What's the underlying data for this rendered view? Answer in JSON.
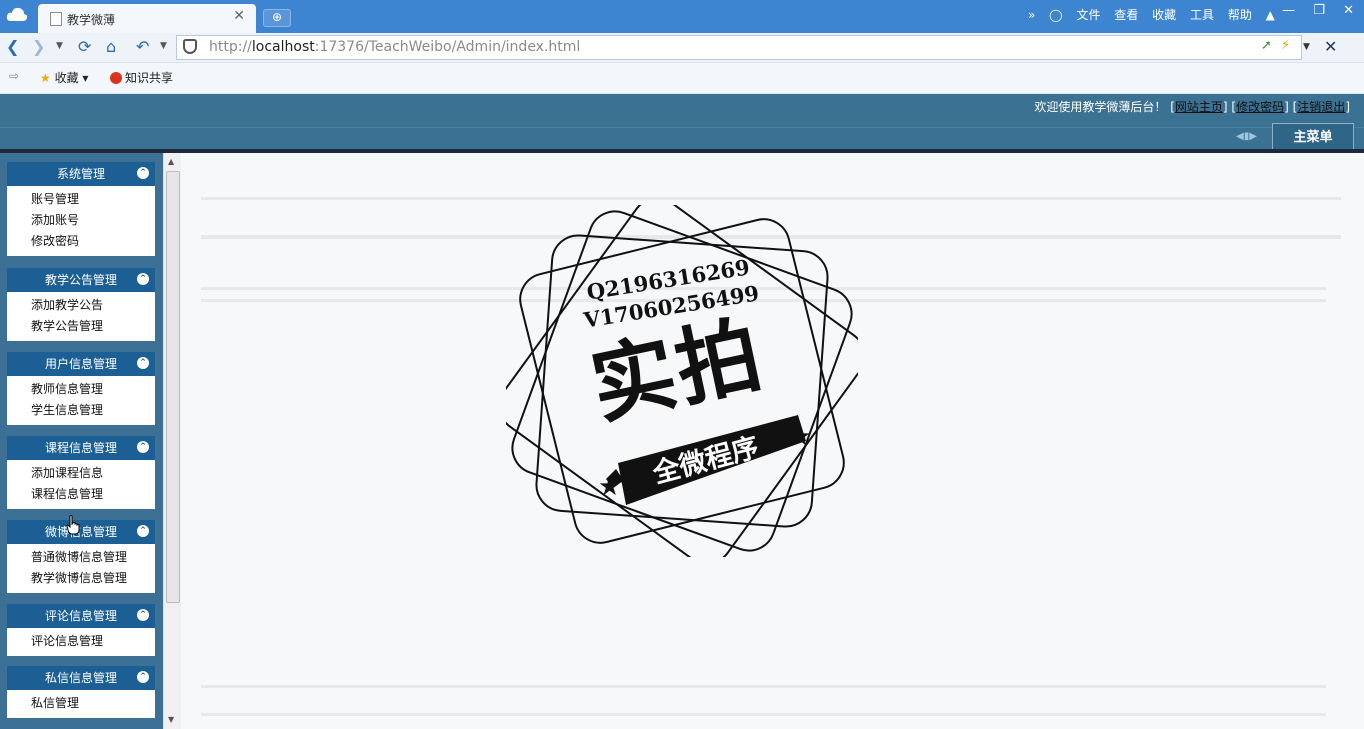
{
  "browser": {
    "tab_title": "教学微薄",
    "tab_close": "✕",
    "new_tab": "⊕",
    "more": "»",
    "menu": [
      "文件",
      "查看",
      "收藏",
      "工具",
      "帮助"
    ],
    "win_buttons": [
      "—",
      "❐",
      "✕"
    ],
    "url_prefix": "http://",
    "url_host": "localhost",
    "url_rest": ":17376/TeachWeibo/Admin/index.html",
    "bookmarks": {
      "favorites": "收藏",
      "knowledge": "知识共享"
    }
  },
  "header": {
    "welcome": "欢迎使用教学微薄后台！",
    "links": [
      "网站主页",
      "修改密码",
      "注销退出"
    ],
    "main_menu": "主菜单"
  },
  "sidebar": {
    "sections": [
      {
        "title": "系统管理",
        "items": [
          "账号管理",
          "添加账号",
          "修改密码"
        ]
      },
      {
        "title": "教学公告管理",
        "items": [
          "添加教学公告",
          "教学公告管理"
        ]
      },
      {
        "title": "用户信息管理",
        "items": [
          "教师信息管理",
          "学生信息管理"
        ]
      },
      {
        "title": "课程信息管理",
        "items": [
          "添加课程信息",
          "课程信息管理"
        ]
      },
      {
        "title": "微博信息管理",
        "items": [
          "普通微博信息管理",
          "教学微博信息管理"
        ]
      },
      {
        "title": "评论信息管理",
        "items": [
          "评论信息管理"
        ]
      },
      {
        "title": "私信信息管理",
        "items": [
          "私信管理"
        ]
      }
    ]
  },
  "watermark": {
    "line1": "Q2196316269",
    "line2": "V17060256499",
    "title": "实拍",
    "ribbon": "全微程序"
  },
  "colors": {
    "chrome_blue": "#3d84d1",
    "header_teal": "#3b7193",
    "section_header": "#1c5f95"
  }
}
